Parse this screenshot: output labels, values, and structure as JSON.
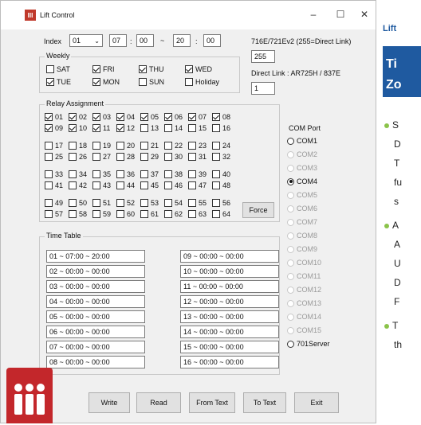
{
  "window": {
    "title": "Lift Control",
    "icon": "III",
    "minimize": "–",
    "maximize": "☐",
    "close": "✕"
  },
  "index": {
    "label": "Index",
    "value": "01",
    "from_h": "07",
    "from_m": "00",
    "tilde": "~",
    "to_h": "20",
    "to_m": "00",
    "colon": ":"
  },
  "weekly": {
    "title": "Weekly",
    "days": [
      {
        "label": "SAT",
        "checked": false
      },
      {
        "label": "FRI",
        "checked": true
      },
      {
        "label": "THU",
        "checked": true
      },
      {
        "label": "WED",
        "checked": true
      },
      {
        "label": "TUE",
        "checked": true
      },
      {
        "label": "MON",
        "checked": true
      },
      {
        "label": "SUN",
        "checked": false
      },
      {
        "label": "Holiday",
        "checked": false
      }
    ]
  },
  "device": {
    "model_label": "716E/721Ev2 (255=Direct Link)",
    "model_value": "255",
    "direct_label": "Direct Link : AR725H / 837E",
    "direct_value": "1"
  },
  "relay": {
    "title": "Relay Assignment",
    "force_label": "Force",
    "items": [
      "01",
      "02",
      "03",
      "04",
      "05",
      "06",
      "07",
      "08",
      "09",
      "10",
      "11",
      "12",
      "13",
      "14",
      "15",
      "16",
      "17",
      "18",
      "19",
      "20",
      "21",
      "22",
      "23",
      "24",
      "25",
      "26",
      "27",
      "28",
      "29",
      "30",
      "31",
      "32",
      "33",
      "34",
      "35",
      "36",
      "37",
      "38",
      "39",
      "40",
      "41",
      "42",
      "43",
      "44",
      "45",
      "46",
      "47",
      "48",
      "49",
      "50",
      "51",
      "52",
      "53",
      "54",
      "55",
      "56",
      "57",
      "58",
      "59",
      "60",
      "61",
      "62",
      "63",
      "64"
    ],
    "checked": [
      "01",
      "02",
      "03",
      "04",
      "05",
      "06",
      "07",
      "08",
      "09",
      "10",
      "11",
      "12"
    ]
  },
  "timetable": {
    "title": "Time Table",
    "left": [
      "01 ~ 07:00 ~ 20:00",
      "02 ~ 00:00 ~ 00:00",
      "03 ~ 00:00 ~ 00:00",
      "04 ~ 00:00 ~ 00:00",
      "05 ~ 00:00 ~ 00:00",
      "06 ~ 00:00 ~ 00:00",
      "07 ~ 00:00 ~ 00:00",
      "08 ~ 00:00 ~ 00:00"
    ],
    "right": [
      "09 ~ 00:00 ~ 00:00",
      "10 ~ 00:00 ~ 00:00",
      "11 ~ 00:00 ~ 00:00",
      "12 ~ 00:00 ~ 00:00",
      "13 ~ 00:00 ~ 00:00",
      "14 ~ 00:00 ~ 00:00",
      "15 ~ 00:00 ~ 00:00",
      "16 ~ 00:00 ~ 00:00"
    ]
  },
  "comport": {
    "title": "COM Port",
    "ports": [
      {
        "label": "COM1",
        "enabled": true,
        "selected": false
      },
      {
        "label": "COM2",
        "enabled": false,
        "selected": false
      },
      {
        "label": "COM3",
        "enabled": false,
        "selected": false
      },
      {
        "label": "COM4",
        "enabled": true,
        "selected": true
      },
      {
        "label": "COM5",
        "enabled": false,
        "selected": false
      },
      {
        "label": "COM6",
        "enabled": false,
        "selected": false
      },
      {
        "label": "COM7",
        "enabled": false,
        "selected": false
      },
      {
        "label": "COM8",
        "enabled": false,
        "selected": false
      },
      {
        "label": "COM9",
        "enabled": false,
        "selected": false
      },
      {
        "label": "COM10",
        "enabled": false,
        "selected": false
      },
      {
        "label": "COM11",
        "enabled": false,
        "selected": false
      },
      {
        "label": "COM12",
        "enabled": false,
        "selected": false
      },
      {
        "label": "COM13",
        "enabled": false,
        "selected": false
      },
      {
        "label": "COM14",
        "enabled": false,
        "selected": false
      },
      {
        "label": "COM15",
        "enabled": false,
        "selected": false
      },
      {
        "label": "701Server",
        "enabled": true,
        "selected": false
      }
    ]
  },
  "buttons": {
    "write": "Write",
    "read": "Read",
    "from_text": "From Text",
    "to_text": "To Text",
    "exit": "Exit"
  },
  "side": {
    "heading": "Lift",
    "subheading": "Ti",
    "subheading2": "Zo",
    "bullets": [
      "S",
      "D",
      "T",
      "fu",
      "s",
      "A",
      "A",
      "U",
      "D",
      "F",
      "T",
      "th"
    ]
  },
  "colors": {
    "accent": "#c3272b",
    "side_heading": "#1f5aa0",
    "side_banner": "#1f5aa0"
  }
}
